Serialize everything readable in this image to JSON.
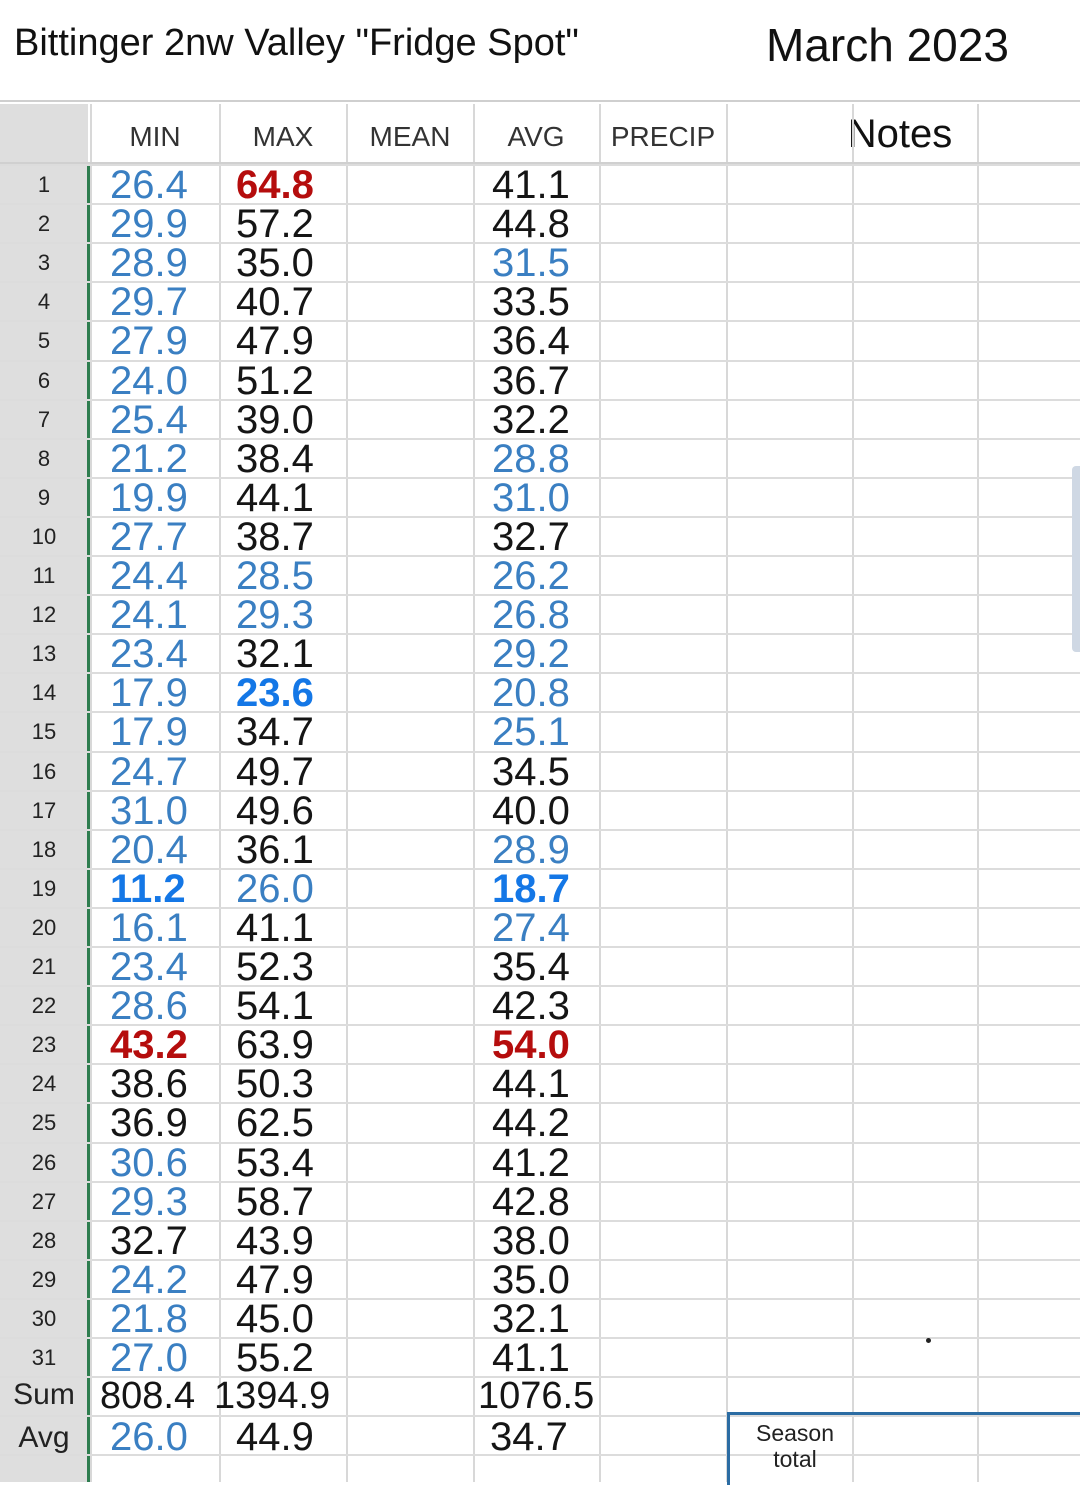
{
  "header": {
    "title": "Bittinger 2nw Valley \"Fridge Spot\"",
    "month": "March 2023"
  },
  "columns": [
    "MIN",
    "MAX",
    "MEAN",
    "AVG",
    "PRECIP"
  ],
  "notes_header": "Notes",
  "colors": {
    "normal": "#151515",
    "below_freezing": "#3a7fc2",
    "record_cold": "#1477e6",
    "record_warm": "#b50d0d",
    "row_header_bg": "#dedede",
    "frozen_pane_line": "#2e7d4f"
  },
  "rows": [
    {
      "day": "1",
      "min": "26.4",
      "min_c": "blue",
      "max": "64.8",
      "max_c": "hot",
      "avg": "41.1",
      "avg_c": "black"
    },
    {
      "day": "2",
      "min": "29.9",
      "min_c": "blue",
      "max": "57.2",
      "max_c": "black",
      "avg": "44.8",
      "avg_c": "black"
    },
    {
      "day": "3",
      "min": "28.9",
      "min_c": "blue",
      "max": "35.0",
      "max_c": "black",
      "avg": "31.5",
      "avg_c": "blue"
    },
    {
      "day": "4",
      "min": "29.7",
      "min_c": "blue",
      "max": "40.7",
      "max_c": "black",
      "avg": "33.5",
      "avg_c": "black"
    },
    {
      "day": "5",
      "min": "27.9",
      "min_c": "blue",
      "max": "47.9",
      "max_c": "black",
      "avg": "36.4",
      "avg_c": "black"
    },
    {
      "day": "6",
      "min": "24.0",
      "min_c": "blue",
      "max": "51.2",
      "max_c": "black",
      "avg": "36.7",
      "avg_c": "black"
    },
    {
      "day": "7",
      "min": "25.4",
      "min_c": "blue",
      "max": "39.0",
      "max_c": "black",
      "avg": "32.2",
      "avg_c": "black"
    },
    {
      "day": "8",
      "min": "21.2",
      "min_c": "blue",
      "max": "38.4",
      "max_c": "black",
      "avg": "28.8",
      "avg_c": "blue"
    },
    {
      "day": "9",
      "min": "19.9",
      "min_c": "blue",
      "max": "44.1",
      "max_c": "black",
      "avg": "31.0",
      "avg_c": "blue"
    },
    {
      "day": "10",
      "min": "27.7",
      "min_c": "blue",
      "max": "38.7",
      "max_c": "black",
      "avg": "32.7",
      "avg_c": "black"
    },
    {
      "day": "11",
      "min": "24.4",
      "min_c": "blue",
      "max": "28.5",
      "max_c": "blue",
      "avg": "26.2",
      "avg_c": "blue"
    },
    {
      "day": "12",
      "min": "24.1",
      "min_c": "blue",
      "max": "29.3",
      "max_c": "blue",
      "avg": "26.8",
      "avg_c": "blue"
    },
    {
      "day": "13",
      "min": "23.4",
      "min_c": "blue",
      "max": "32.1",
      "max_c": "black",
      "avg": "29.2",
      "avg_c": "blue"
    },
    {
      "day": "14",
      "min": "17.9",
      "min_c": "blue",
      "max": "23.6",
      "max_c": "cold",
      "avg": "20.8",
      "avg_c": "blue"
    },
    {
      "day": "15",
      "min": "17.9",
      "min_c": "blue",
      "max": "34.7",
      "max_c": "black",
      "avg": "25.1",
      "avg_c": "blue"
    },
    {
      "day": "16",
      "min": "24.7",
      "min_c": "blue",
      "max": "49.7",
      "max_c": "black",
      "avg": "34.5",
      "avg_c": "black"
    },
    {
      "day": "17",
      "min": "31.0",
      "min_c": "blue",
      "max": "49.6",
      "max_c": "black",
      "avg": "40.0",
      "avg_c": "black"
    },
    {
      "day": "18",
      "min": "20.4",
      "min_c": "blue",
      "max": "36.1",
      "max_c": "black",
      "avg": "28.9",
      "avg_c": "blue"
    },
    {
      "day": "19",
      "min": "11.2",
      "min_c": "cold",
      "max": "26.0",
      "max_c": "blue",
      "avg": "18.7",
      "avg_c": "cold"
    },
    {
      "day": "20",
      "min": "16.1",
      "min_c": "blue",
      "max": "41.1",
      "max_c": "black",
      "avg": "27.4",
      "avg_c": "blue"
    },
    {
      "day": "21",
      "min": "23.4",
      "min_c": "blue",
      "max": "52.3",
      "max_c": "black",
      "avg": "35.4",
      "avg_c": "black"
    },
    {
      "day": "22",
      "min": "28.6",
      "min_c": "blue",
      "max": "54.1",
      "max_c": "black",
      "avg": "42.3",
      "avg_c": "black"
    },
    {
      "day": "23",
      "min": "43.2",
      "min_c": "hot",
      "max": "63.9",
      "max_c": "black",
      "avg": "54.0",
      "avg_c": "hot"
    },
    {
      "day": "24",
      "min": "38.6",
      "min_c": "black",
      "max": "50.3",
      "max_c": "black",
      "avg": "44.1",
      "avg_c": "black"
    },
    {
      "day": "25",
      "min": "36.9",
      "min_c": "black",
      "max": "62.5",
      "max_c": "black",
      "avg": "44.2",
      "avg_c": "black"
    },
    {
      "day": "26",
      "min": "30.6",
      "min_c": "blue",
      "max": "53.4",
      "max_c": "black",
      "avg": "41.2",
      "avg_c": "black"
    },
    {
      "day": "27",
      "min": "29.3",
      "min_c": "blue",
      "max": "58.7",
      "max_c": "black",
      "avg": "42.8",
      "avg_c": "black"
    },
    {
      "day": "28",
      "min": "32.7",
      "min_c": "black",
      "max": "43.9",
      "max_c": "black",
      "avg": "38.0",
      "avg_c": "black"
    },
    {
      "day": "29",
      "min": "24.2",
      "min_c": "blue",
      "max": "47.9",
      "max_c": "black",
      "avg": "35.0",
      "avg_c": "black"
    },
    {
      "day": "30",
      "min": "21.8",
      "min_c": "blue",
      "max": "45.0",
      "max_c": "black",
      "avg": "32.1",
      "avg_c": "black"
    },
    {
      "day": "31",
      "min": "27.0",
      "min_c": "blue",
      "max": "55.2",
      "max_c": "black",
      "avg": "41.1",
      "avg_c": "black"
    }
  ],
  "summary": {
    "sum": {
      "label": "Sum",
      "min": "808.4",
      "max": "1394.9",
      "avg": "1076.5"
    },
    "avg": {
      "label": "Avg",
      "min": "26.0",
      "max": "44.9",
      "avg": "34.7"
    }
  },
  "season_total_label": "Season total"
}
